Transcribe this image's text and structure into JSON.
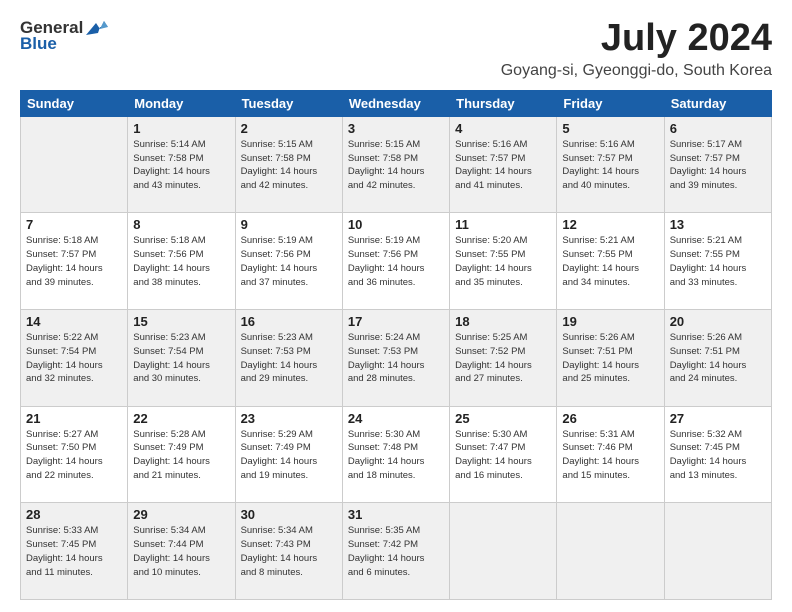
{
  "header": {
    "logo_general": "General",
    "logo_blue": "Blue",
    "month_title": "July 2024",
    "location": "Goyang-si, Gyeonggi-do, South Korea"
  },
  "days_of_week": [
    "Sunday",
    "Monday",
    "Tuesday",
    "Wednesday",
    "Thursday",
    "Friday",
    "Saturday"
  ],
  "weeks": [
    [
      {
        "day": "",
        "info": ""
      },
      {
        "day": "1",
        "info": "Sunrise: 5:14 AM\nSunset: 7:58 PM\nDaylight: 14 hours\nand 43 minutes."
      },
      {
        "day": "2",
        "info": "Sunrise: 5:15 AM\nSunset: 7:58 PM\nDaylight: 14 hours\nand 42 minutes."
      },
      {
        "day": "3",
        "info": "Sunrise: 5:15 AM\nSunset: 7:58 PM\nDaylight: 14 hours\nand 42 minutes."
      },
      {
        "day": "4",
        "info": "Sunrise: 5:16 AM\nSunset: 7:57 PM\nDaylight: 14 hours\nand 41 minutes."
      },
      {
        "day": "5",
        "info": "Sunrise: 5:16 AM\nSunset: 7:57 PM\nDaylight: 14 hours\nand 40 minutes."
      },
      {
        "day": "6",
        "info": "Sunrise: 5:17 AM\nSunset: 7:57 PM\nDaylight: 14 hours\nand 39 minutes."
      }
    ],
    [
      {
        "day": "7",
        "info": "Sunrise: 5:18 AM\nSunset: 7:57 PM\nDaylight: 14 hours\nand 39 minutes."
      },
      {
        "day": "8",
        "info": "Sunrise: 5:18 AM\nSunset: 7:56 PM\nDaylight: 14 hours\nand 38 minutes."
      },
      {
        "day": "9",
        "info": "Sunrise: 5:19 AM\nSunset: 7:56 PM\nDaylight: 14 hours\nand 37 minutes."
      },
      {
        "day": "10",
        "info": "Sunrise: 5:19 AM\nSunset: 7:56 PM\nDaylight: 14 hours\nand 36 minutes."
      },
      {
        "day": "11",
        "info": "Sunrise: 5:20 AM\nSunset: 7:55 PM\nDaylight: 14 hours\nand 35 minutes."
      },
      {
        "day": "12",
        "info": "Sunrise: 5:21 AM\nSunset: 7:55 PM\nDaylight: 14 hours\nand 34 minutes."
      },
      {
        "day": "13",
        "info": "Sunrise: 5:21 AM\nSunset: 7:55 PM\nDaylight: 14 hours\nand 33 minutes."
      }
    ],
    [
      {
        "day": "14",
        "info": "Sunrise: 5:22 AM\nSunset: 7:54 PM\nDaylight: 14 hours\nand 32 minutes."
      },
      {
        "day": "15",
        "info": "Sunrise: 5:23 AM\nSunset: 7:54 PM\nDaylight: 14 hours\nand 30 minutes."
      },
      {
        "day": "16",
        "info": "Sunrise: 5:23 AM\nSunset: 7:53 PM\nDaylight: 14 hours\nand 29 minutes."
      },
      {
        "day": "17",
        "info": "Sunrise: 5:24 AM\nSunset: 7:53 PM\nDaylight: 14 hours\nand 28 minutes."
      },
      {
        "day": "18",
        "info": "Sunrise: 5:25 AM\nSunset: 7:52 PM\nDaylight: 14 hours\nand 27 minutes."
      },
      {
        "day": "19",
        "info": "Sunrise: 5:26 AM\nSunset: 7:51 PM\nDaylight: 14 hours\nand 25 minutes."
      },
      {
        "day": "20",
        "info": "Sunrise: 5:26 AM\nSunset: 7:51 PM\nDaylight: 14 hours\nand 24 minutes."
      }
    ],
    [
      {
        "day": "21",
        "info": "Sunrise: 5:27 AM\nSunset: 7:50 PM\nDaylight: 14 hours\nand 22 minutes."
      },
      {
        "day": "22",
        "info": "Sunrise: 5:28 AM\nSunset: 7:49 PM\nDaylight: 14 hours\nand 21 minutes."
      },
      {
        "day": "23",
        "info": "Sunrise: 5:29 AM\nSunset: 7:49 PM\nDaylight: 14 hours\nand 19 minutes."
      },
      {
        "day": "24",
        "info": "Sunrise: 5:30 AM\nSunset: 7:48 PM\nDaylight: 14 hours\nand 18 minutes."
      },
      {
        "day": "25",
        "info": "Sunrise: 5:30 AM\nSunset: 7:47 PM\nDaylight: 14 hours\nand 16 minutes."
      },
      {
        "day": "26",
        "info": "Sunrise: 5:31 AM\nSunset: 7:46 PM\nDaylight: 14 hours\nand 15 minutes."
      },
      {
        "day": "27",
        "info": "Sunrise: 5:32 AM\nSunset: 7:45 PM\nDaylight: 14 hours\nand 13 minutes."
      }
    ],
    [
      {
        "day": "28",
        "info": "Sunrise: 5:33 AM\nSunset: 7:45 PM\nDaylight: 14 hours\nand 11 minutes."
      },
      {
        "day": "29",
        "info": "Sunrise: 5:34 AM\nSunset: 7:44 PM\nDaylight: 14 hours\nand 10 minutes."
      },
      {
        "day": "30",
        "info": "Sunrise: 5:34 AM\nSunset: 7:43 PM\nDaylight: 14 hours\nand 8 minutes."
      },
      {
        "day": "31",
        "info": "Sunrise: 5:35 AM\nSunset: 7:42 PM\nDaylight: 14 hours\nand 6 minutes."
      },
      {
        "day": "",
        "info": ""
      },
      {
        "day": "",
        "info": ""
      },
      {
        "day": "",
        "info": ""
      }
    ]
  ]
}
